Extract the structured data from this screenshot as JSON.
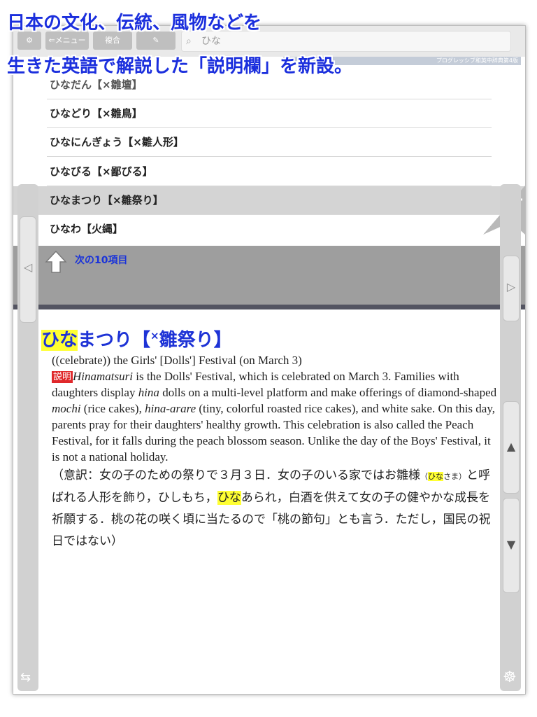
{
  "overlay": {
    "line1": "日本の文化、伝統、風物などを",
    "line2": "生きた英語で解説した「説明欄」を新設。"
  },
  "toolbar": {
    "settings_icon": "gear-icon",
    "menu_label": "⇐メニュー",
    "combo_label": "複合",
    "handwrite_icon": "pen-icon"
  },
  "search": {
    "value": "ひな"
  },
  "dictionary_name": "プログレッシブ和英中辞典第4版",
  "word_list": [
    "ひなだん【×雛壇】",
    "ひなどり【×雛鳥】",
    "ひなにんぎょう【×雛人形】",
    "ひなびる【×鄙びる】",
    "ひなまつり【×雛祭り】",
    "ひなわ【火縄】"
  ],
  "next_items_label": "次の10項目",
  "entry": {
    "head_highlight": "ひな",
    "head_rest": "まつり【",
    "head_cross": "×",
    "head_tail": "雛祭り】",
    "sense": "((celebrate)) the Girls' [Dolls'] Festival (on March 3)",
    "explanation_badge": "説明",
    "exp_1": "Hinamatsuri",
    "exp_2": " is the Dolls' Festival, which is celebrated on March 3. Families with daughters display ",
    "exp_3": "hina",
    "exp_4": " dolls on a multi-level platform and make offerings of diamond-shaped ",
    "exp_5": "mochi",
    "exp_6": " (rice cakes), ",
    "exp_7": "hina-arare",
    "exp_8": " (tiny, colorful roasted rice cakes), and white sake. On this day, parents pray for their daughters' healthy growth. This celebration is also called the Peach Festival, for it falls during the peach blossom season. Unlike the day of the Boys' Festival, it is not a national holiday.",
    "ja_1": "（意訳：女の子のための祭りで３月３日．女の子のいる家ではお雛様",
    "ja_small_open": "（",
    "ja_small_hl": "ひな",
    "ja_small_rest": "さま）",
    "ja_2": "と呼ばれる人形を飾り，ひしもち，",
    "ja_hl": "ひな",
    "ja_3": "あられ，白酒を供えて女の子の健やかな成長を祈願する．桃の花の咲く頃に当たるので「桃の節句」とも言う．ただし，国民の祝日ではない）"
  },
  "colors": {
    "accent_blue": "#1e33d6",
    "highlight": "#ffff33",
    "badge_red": "#e0282b",
    "divider": "#535461"
  }
}
